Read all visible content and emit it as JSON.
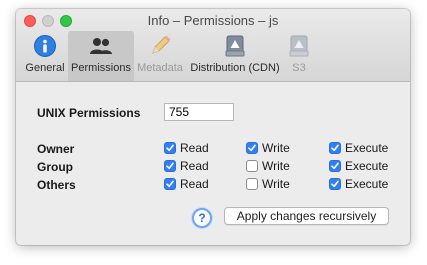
{
  "window": {
    "title": "Info – Permissions – js"
  },
  "tabs": [
    {
      "label": "General",
      "icon": "info-icon",
      "selected": false,
      "disabled": false
    },
    {
      "label": "Permissions",
      "icon": "users-icon",
      "selected": true,
      "disabled": false
    },
    {
      "label": "Metadata",
      "icon": "pencil-icon",
      "selected": false,
      "disabled": true
    },
    {
      "label": "Distribution (CDN)",
      "icon": "cloud-drive-icon",
      "selected": false,
      "disabled": false
    },
    {
      "label": "S3",
      "icon": "drive-icon",
      "selected": false,
      "disabled": true
    }
  ],
  "permissions": {
    "unix_label": "UNIX Permissions",
    "unix_value": "755",
    "columns": [
      "Read",
      "Write",
      "Execute"
    ],
    "rows": [
      {
        "label": "Owner",
        "read": true,
        "write": true,
        "execute": true
      },
      {
        "label": "Group",
        "read": true,
        "write": false,
        "execute": true
      },
      {
        "label": "Others",
        "read": true,
        "write": false,
        "execute": true
      }
    ]
  },
  "actions": {
    "help_symbol": "?",
    "apply_label": "Apply changes recursively"
  },
  "colors": {
    "accent": "#2f7ff5",
    "close": "#fc5f57",
    "zoom": "#33c748"
  }
}
